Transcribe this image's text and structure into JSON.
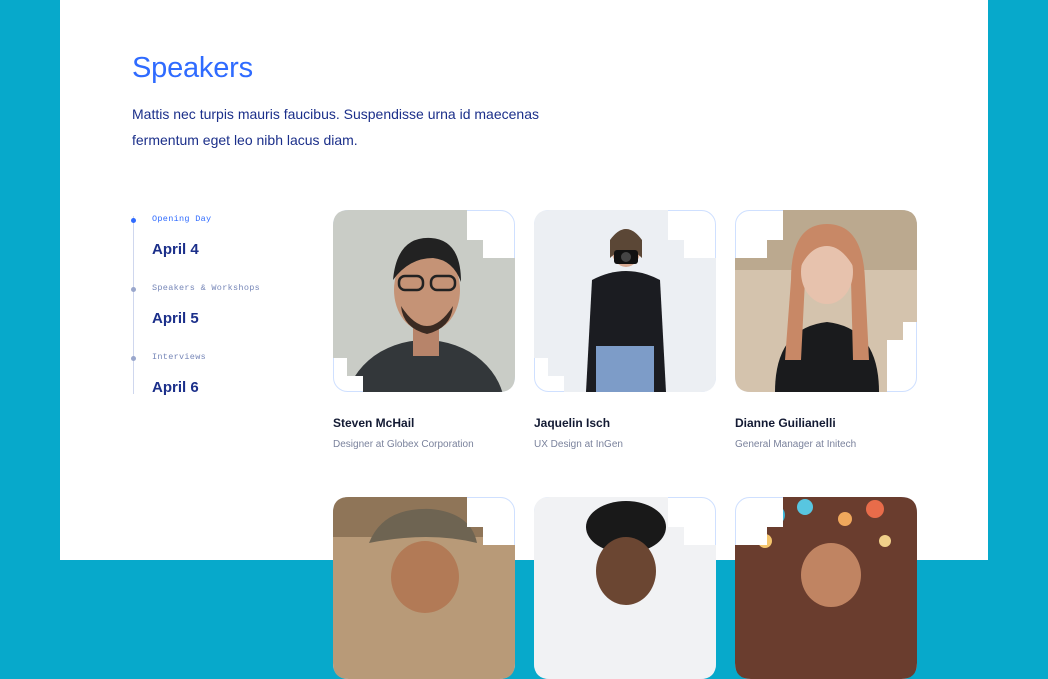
{
  "section": {
    "title": "Speakers",
    "intro": "Mattis nec turpis mauris faucibus. Suspendisse urna id maecenas fermentum eget leo nibh lacus diam."
  },
  "schedule": [
    {
      "label": "Opening Day",
      "date": "April 4",
      "active": true
    },
    {
      "label": "Speakers & Workshops",
      "date": "April 5",
      "active": false
    },
    {
      "label": "Interviews",
      "date": "April 6",
      "active": false
    }
  ],
  "speakers": [
    {
      "name": "Steven McHail",
      "role": "Designer at Globex Corporation"
    },
    {
      "name": "Jaquelin Isch",
      "role": "UX Design at InGen"
    },
    {
      "name": "Dianne Guilianelli",
      "role": "General Manager at Initech"
    },
    {
      "name": "",
      "role": ""
    },
    {
      "name": "",
      "role": ""
    },
    {
      "name": "",
      "role": ""
    }
  ],
  "colors": {
    "outer_background": "#07a9cb",
    "accent": "#2f6bff",
    "heading_text": "#1b2f8a",
    "frame_outline": "#cfe0ff"
  }
}
